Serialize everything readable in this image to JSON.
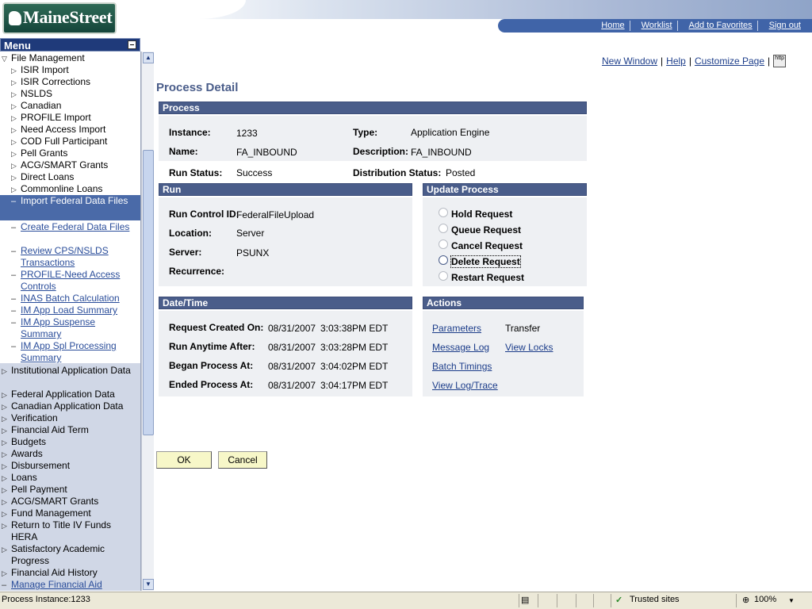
{
  "header": {
    "logo_text": "MaineStreet",
    "nav": [
      "Home",
      "Worklist",
      "Add to Favorites",
      "Sign out"
    ]
  },
  "sidebar": {
    "title": "Menu",
    "items": [
      {
        "label": "File Management",
        "type": "open-folder"
      },
      {
        "label": "ISIR Import",
        "type": "folder"
      },
      {
        "label": "ISIR Corrections",
        "type": "folder"
      },
      {
        "label": "NSLDS",
        "type": "folder"
      },
      {
        "label": "Canadian",
        "type": "folder"
      },
      {
        "label": "PROFILE Import",
        "type": "folder"
      },
      {
        "label": "Need Access Import",
        "type": "folder"
      },
      {
        "label": "COD Full Participant",
        "type": "folder"
      },
      {
        "label": "Pell Grants",
        "type": "folder"
      },
      {
        "label": "ACG/SMART Grants",
        "type": "folder"
      },
      {
        "label": "Direct Loans",
        "type": "folder"
      },
      {
        "label": "Commonline Loans",
        "type": "folder"
      },
      {
        "label": "Import Federal Data Files",
        "type": "active"
      },
      {
        "label": "Create Federal Data Files",
        "type": "leaf"
      },
      {
        "label": "Review CPS/NSLDS Transactions",
        "type": "leaf"
      },
      {
        "label": "PROFILE-Need Access Controls",
        "type": "leaf"
      },
      {
        "label": "INAS Batch Calculation",
        "type": "leaf"
      },
      {
        "label": "IM App Load Summary",
        "type": "leaf"
      },
      {
        "label": "IM App Suspense Summary",
        "type": "leaf"
      },
      {
        "label": "IM App Spl Processing Summary",
        "type": "leaf"
      },
      {
        "label": "Institutional Application Data",
        "type": "folder"
      },
      {
        "label": "Federal Application Data",
        "type": "folder"
      },
      {
        "label": "Canadian Application Data",
        "type": "folder"
      },
      {
        "label": "Verification",
        "type": "folder"
      },
      {
        "label": "Financial Aid Term",
        "type": "folder"
      },
      {
        "label": "Budgets",
        "type": "folder"
      },
      {
        "label": "Awards",
        "type": "folder"
      },
      {
        "label": "Disbursement",
        "type": "folder"
      },
      {
        "label": "Loans",
        "type": "folder"
      },
      {
        "label": "Pell Payment",
        "type": "folder"
      },
      {
        "label": "ACG/SMART Grants",
        "type": "folder"
      },
      {
        "label": "Fund Management",
        "type": "folder"
      },
      {
        "label": "Return to Title IV Funds",
        "type": "folder"
      },
      {
        "label": "HERA",
        "type": "plain"
      },
      {
        "label": "Satisfactory Academic Progress",
        "type": "folder"
      },
      {
        "label": "Financial Aid History",
        "type": "folder"
      },
      {
        "label": "Manage Financial Aid",
        "type": "leaf"
      }
    ]
  },
  "toplinks": [
    "New Window",
    "Help",
    "Customize Page"
  ],
  "toplinks_icon_text": "http",
  "page_title": "Process Detail",
  "process": {
    "heading": "Process",
    "instance_label": "Instance:",
    "instance": "1233",
    "type_label": "Type:",
    "type": "Application Engine",
    "name_label": "Name:",
    "name": "FA_INBOUND",
    "description_label": "Description:",
    "description": "FA_INBOUND",
    "run_status_label": "Run Status:",
    "run_status": "Success",
    "dist_status_label": "Distribution Status:",
    "dist_status": "Posted"
  },
  "run": {
    "heading": "Run",
    "run_control_label": "Run Control ID:",
    "run_control": "FederalFileUpload",
    "location_label": "Location:",
    "location": "Server",
    "server_label": "Server:",
    "server": "PSUNX",
    "recurrence_label": "Recurrence:"
  },
  "update_process": {
    "heading": "Update Process",
    "options": [
      "Hold Request",
      "Queue Request",
      "Cancel Request",
      "Delete Request",
      "Restart Request"
    ]
  },
  "datetime": {
    "heading": "Date/Time",
    "rows": [
      {
        "label": "Request Created On:",
        "date": "08/31/2007",
        "time": "3:03:38PM EDT"
      },
      {
        "label": "Run Anytime After:",
        "date": "08/31/2007",
        "time": "3:03:28PM EDT"
      },
      {
        "label": "Began Process At:",
        "date": "08/31/2007",
        "time": "3:04:02PM EDT"
      },
      {
        "label": "Ended Process At:",
        "date": "08/31/2007",
        "time": "3:04:17PM EDT"
      }
    ]
  },
  "actions": {
    "heading": "Actions",
    "parameters": "Parameters",
    "transfer": "Transfer",
    "message_log": "Message Log",
    "view_locks": "View Locks",
    "batch_timings": "Batch Timings",
    "view_log": "View Log/Trace"
  },
  "buttons": {
    "ok": "OK",
    "cancel": "Cancel"
  },
  "statusbar": {
    "text": "Process Instance:1233",
    "zone": "Trusted sites",
    "zoom": "100%"
  }
}
